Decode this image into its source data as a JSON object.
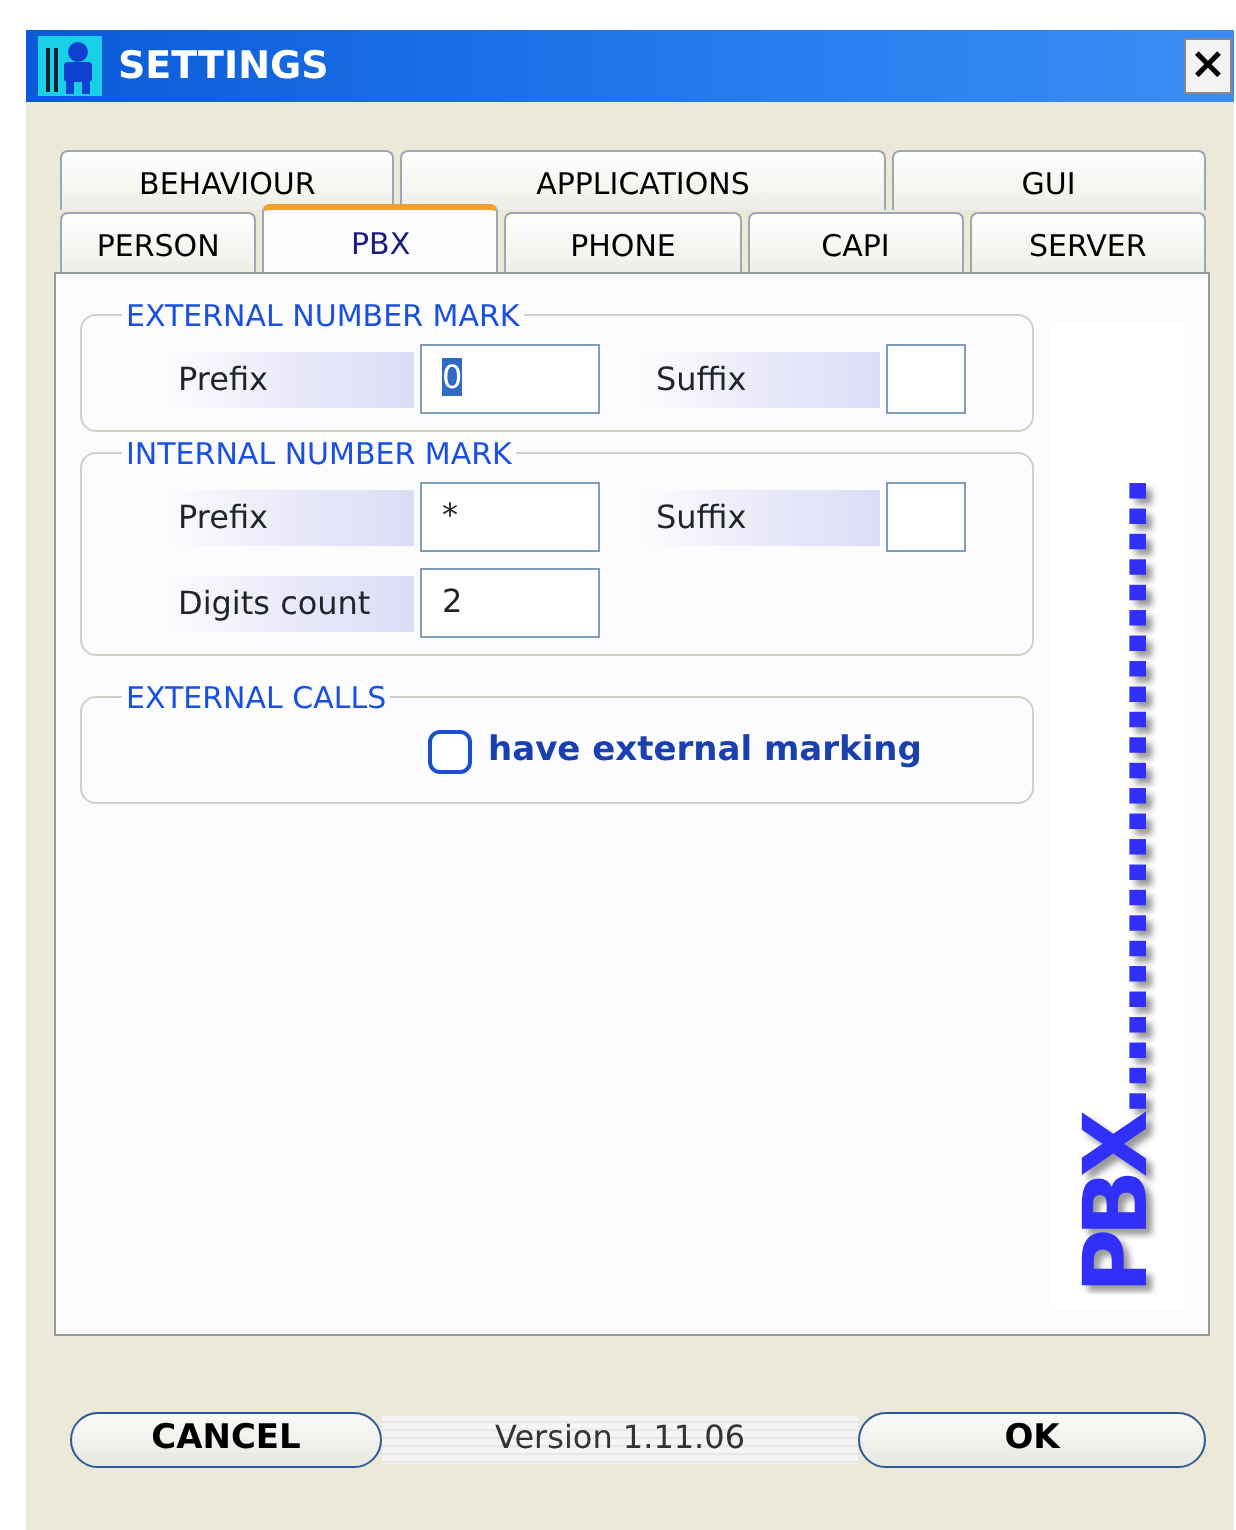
{
  "window": {
    "title": "SETTINGS",
    "close": "×"
  },
  "tab_rows": [
    [
      {
        "label": "BEHAVIOUR",
        "selected": false
      },
      {
        "label": "APPLICATIONS",
        "selected": false
      },
      {
        "label": "GUI",
        "selected": false
      }
    ],
    [
      {
        "label": "PERSON",
        "selected": false
      },
      {
        "label": "PBX",
        "selected": true
      },
      {
        "label": "PHONE",
        "selected": false
      },
      {
        "label": "CAPI",
        "selected": false
      },
      {
        "label": "SERVER",
        "selected": false
      }
    ]
  ],
  "groups": [
    {
      "title": "EXTERNAL NUMBER MARK",
      "rows": [
        [
          {
            "label": "Prefix",
            "value": "0",
            "selected": true
          },
          {
            "label": "Suffix"
          }
        ]
      ]
    },
    {
      "title": "INTERNAL NUMBER MARK",
      "rows": [
        [
          {
            "label": "Prefix",
            "value": "*"
          },
          {
            "label": "Suffix"
          }
        ],
        [
          {
            "label": "Digits count",
            "value": "2"
          }
        ]
      ]
    },
    {
      "title": "EXTERNAL CALLS",
      "checkbox": {
        "label": "have external marking",
        "checked": false
      }
    }
  ],
  "banner": "PBX.........................",
  "footer": {
    "cancel": "CANCEL",
    "version": "Version 1.11.06",
    "ok": "OK"
  }
}
